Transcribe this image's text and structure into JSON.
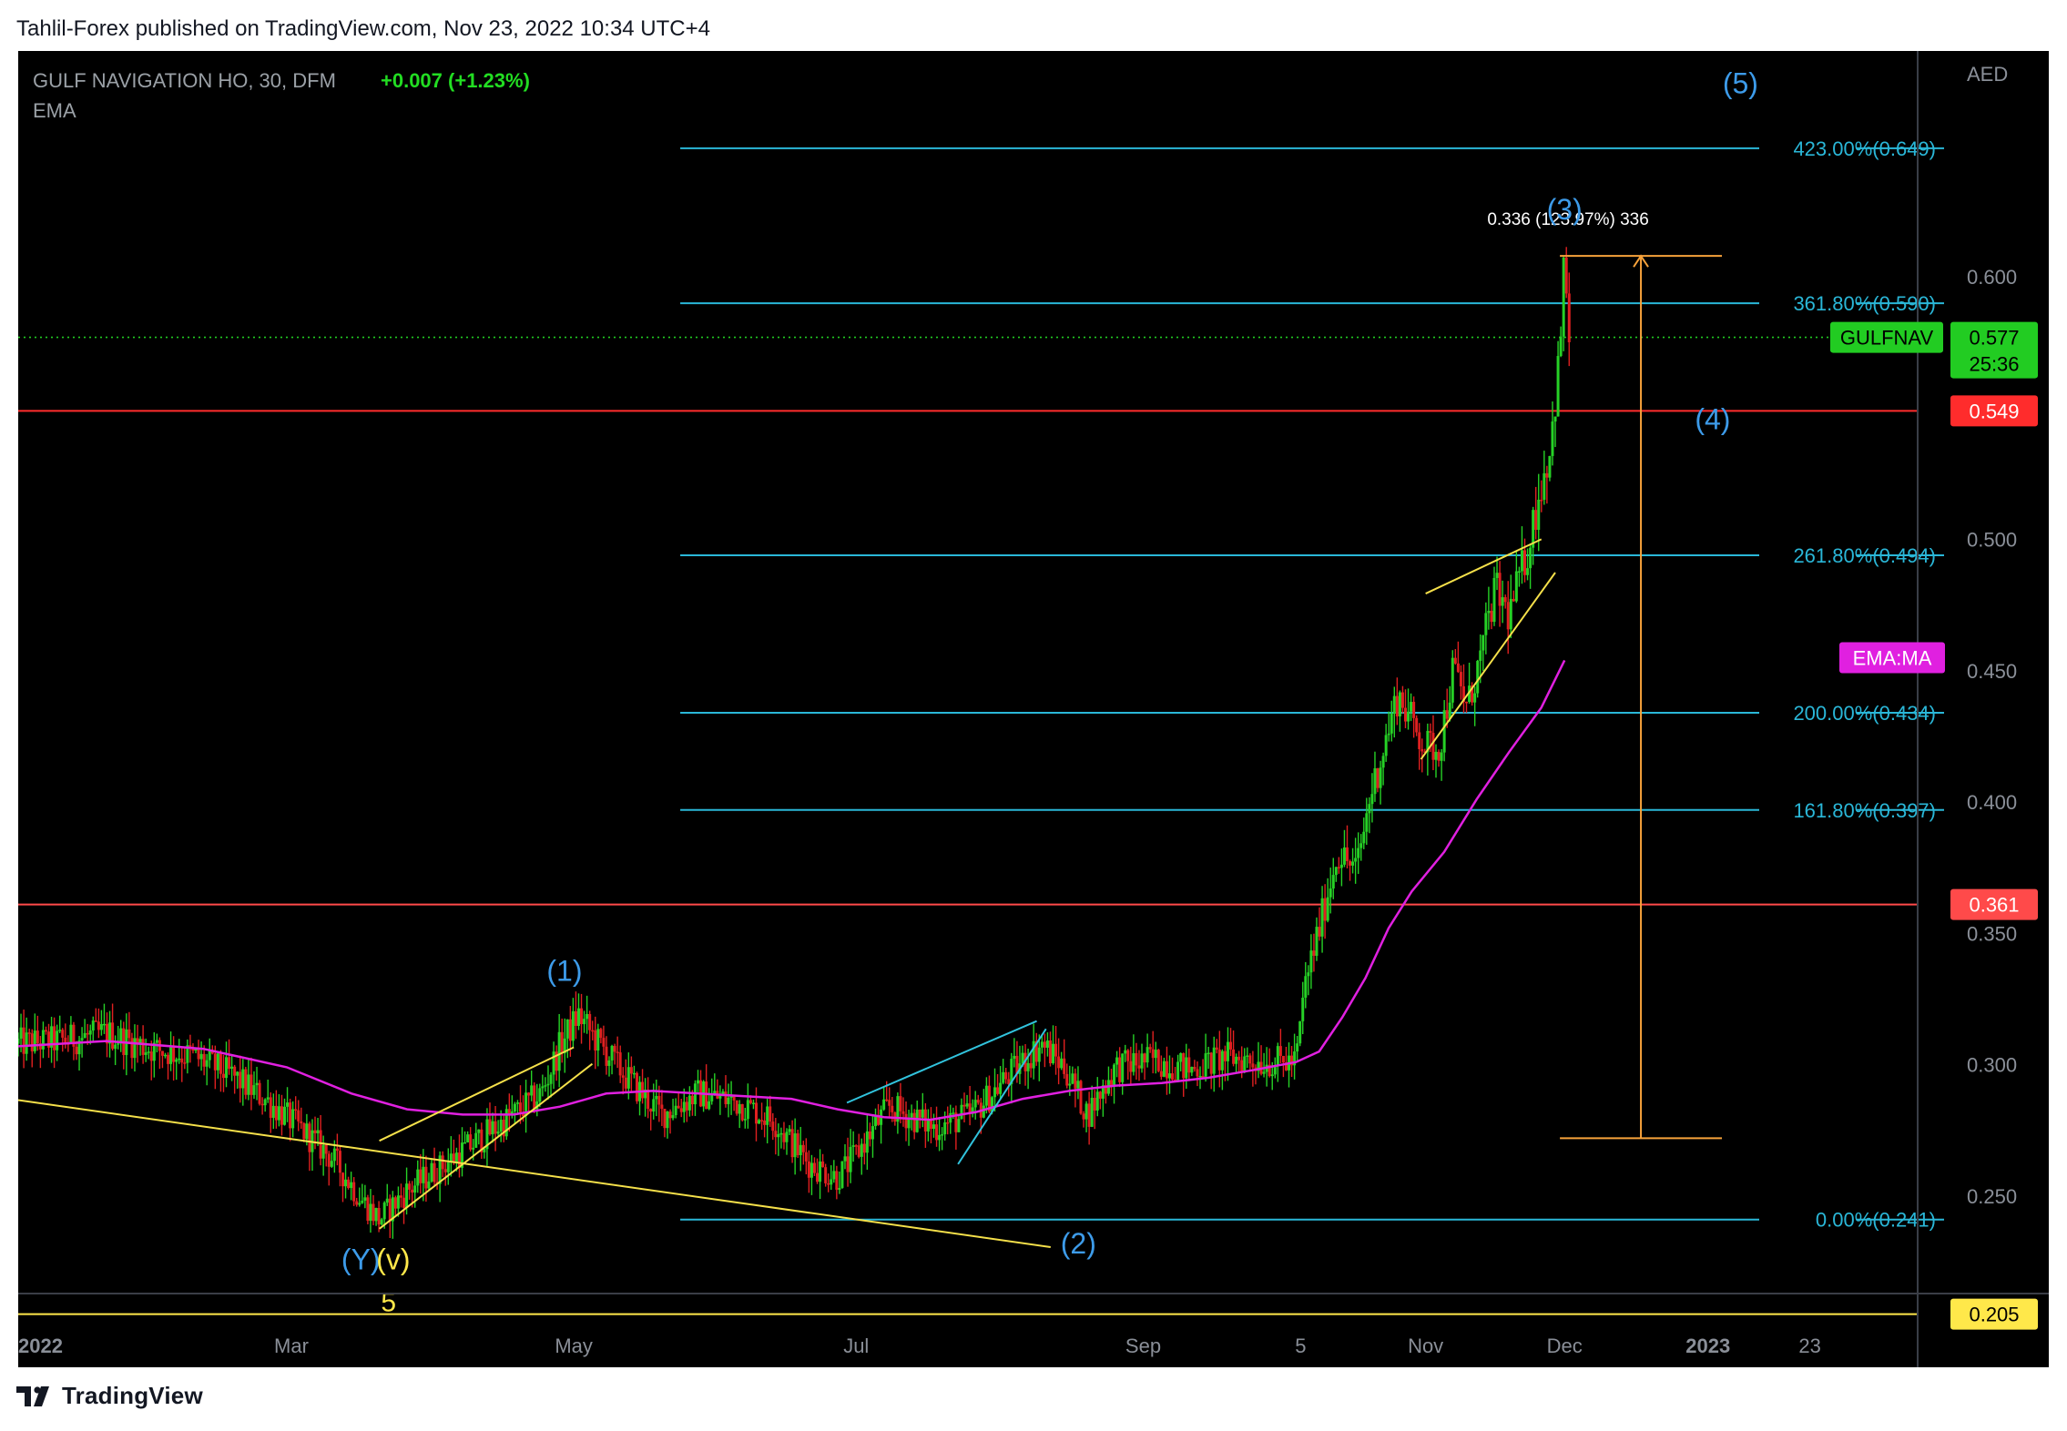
{
  "caption": "Tahlil-Forex published on TradingView.com, Nov 23, 2022 10:34 UTC+4",
  "brand": "TradingView",
  "chart_data": {
    "type": "candlestick",
    "symbol_line": "GULF NAVIGATION HO, 30, DFM",
    "change": "+0.007 (+1.23%)",
    "indicator": "EMA",
    "currency": "AED",
    "ylim": [
      0.184,
      0.664
    ],
    "y_ticks": [
      "0.250",
      "0.300",
      "0.350",
      "0.400",
      "0.450",
      "0.500",
      "0.600"
    ],
    "x_ticks": [
      "2022",
      "Mar",
      "May",
      "Jul",
      "Sep",
      "5",
      "Nov",
      "Dec",
      "2023",
      "23"
    ],
    "x_tick_dates": [
      "2022-01-01",
      "2022-03-01",
      "2022-05-01",
      "2022-07-01",
      "2022-09-01",
      "2022-10-05",
      "2022-11-01",
      "2022-12-01",
      "2023-01-01",
      "2023-01-23"
    ],
    "x_range": [
      "2022-01-01",
      "2023-02-20"
    ],
    "close_path": [
      [
        "2022-01-01",
        0.308
      ],
      [
        "2022-01-10",
        0.309
      ],
      [
        "2022-01-20",
        0.312
      ],
      [
        "2022-01-30",
        0.306
      ],
      [
        "2022-02-08",
        0.303
      ],
      [
        "2022-02-16",
        0.296
      ],
      [
        "2022-02-24",
        0.286
      ],
      [
        "2022-03-04",
        0.274
      ],
      [
        "2022-03-10",
        0.264
      ],
      [
        "2022-03-16",
        0.249
      ],
      [
        "2022-03-20",
        0.241
      ],
      [
        "2022-03-26",
        0.252
      ],
      [
        "2022-04-03",
        0.262
      ],
      [
        "2022-04-11",
        0.272
      ],
      [
        "2022-04-18",
        0.281
      ],
      [
        "2022-04-24",
        0.289
      ],
      [
        "2022-04-28",
        0.307
      ],
      [
        "2022-05-02",
        0.319
      ],
      [
        "2022-05-06",
        0.309
      ],
      [
        "2022-05-12",
        0.296
      ],
      [
        "2022-05-20",
        0.281
      ],
      [
        "2022-05-28",
        0.289
      ],
      [
        "2022-06-05",
        0.286
      ],
      [
        "2022-06-13",
        0.279
      ],
      [
        "2022-06-21",
        0.262
      ],
      [
        "2022-06-27",
        0.257
      ],
      [
        "2022-07-01",
        0.266
      ],
      [
        "2022-07-08",
        0.284
      ],
      [
        "2022-07-18",
        0.276
      ],
      [
        "2022-07-26",
        0.281
      ],
      [
        "2022-08-03",
        0.296
      ],
      [
        "2022-08-10",
        0.308
      ],
      [
        "2022-08-15",
        0.299
      ],
      [
        "2022-08-20",
        0.281
      ],
      [
        "2022-08-26",
        0.299
      ],
      [
        "2022-09-03",
        0.302
      ],
      [
        "2022-09-11",
        0.298
      ],
      [
        "2022-09-19",
        0.303
      ],
      [
        "2022-09-27",
        0.301
      ],
      [
        "2022-10-04",
        0.301
      ],
      [
        "2022-10-06",
        0.331
      ],
      [
        "2022-10-09",
        0.352
      ],
      [
        "2022-10-13",
        0.381
      ],
      [
        "2022-10-17",
        0.374
      ],
      [
        "2022-10-20",
        0.402
      ],
      [
        "2022-10-23",
        0.421
      ],
      [
        "2022-10-26",
        0.441
      ],
      [
        "2022-10-29",
        0.431
      ],
      [
        "2022-11-01",
        0.421
      ],
      [
        "2022-11-04",
        0.421
      ],
      [
        "2022-11-07",
        0.451
      ],
      [
        "2022-11-10",
        0.436
      ],
      [
        "2022-11-13",
        0.456
      ],
      [
        "2022-11-16",
        0.481
      ],
      [
        "2022-11-19",
        0.471
      ],
      [
        "2022-11-23",
        0.496
      ],
      [
        "2022-11-26",
        0.521
      ],
      [
        "2022-11-28",
        0.536
      ],
      [
        "2022-11-30",
        0.571
      ],
      [
        "2022-12-01",
        0.608
      ],
      [
        "2022-12-02",
        0.577
      ]
    ],
    "ema_path": [
      [
        "2022-01-01",
        0.307
      ],
      [
        "2022-01-20",
        0.309
      ],
      [
        "2022-02-10",
        0.306
      ],
      [
        "2022-02-28",
        0.299
      ],
      [
        "2022-03-14",
        0.289
      ],
      [
        "2022-03-26",
        0.283
      ],
      [
        "2022-04-07",
        0.281
      ],
      [
        "2022-04-18",
        0.281
      ],
      [
        "2022-04-28",
        0.284
      ],
      [
        "2022-05-08",
        0.289
      ],
      [
        "2022-05-18",
        0.29
      ],
      [
        "2022-05-28",
        0.289
      ],
      [
        "2022-06-07",
        0.288
      ],
      [
        "2022-06-17",
        0.287
      ],
      [
        "2022-06-27",
        0.283
      ],
      [
        "2022-07-07",
        0.28
      ],
      [
        "2022-07-17",
        0.279
      ],
      [
        "2022-07-27",
        0.282
      ],
      [
        "2022-08-06",
        0.287
      ],
      [
        "2022-08-16",
        0.29
      ],
      [
        "2022-08-26",
        0.292
      ],
      [
        "2022-09-05",
        0.293
      ],
      [
        "2022-09-15",
        0.295
      ],
      [
        "2022-09-25",
        0.298
      ],
      [
        "2022-10-04",
        0.301
      ],
      [
        "2022-10-09",
        0.305
      ],
      [
        "2022-10-14",
        0.318
      ],
      [
        "2022-10-19",
        0.333
      ],
      [
        "2022-10-24",
        0.352
      ],
      [
        "2022-10-29",
        0.366
      ],
      [
        "2022-11-05",
        0.381
      ],
      [
        "2022-11-12",
        0.401
      ],
      [
        "2022-11-19",
        0.419
      ],
      [
        "2022-11-26",
        0.436
      ],
      [
        "2022-12-01",
        0.454
      ]
    ],
    "fib_levels": [
      {
        "label": "423.00%(0.649)",
        "value": 0.649
      },
      {
        "label": "361.80%(0.590)",
        "value": 0.59
      },
      {
        "label": "261.80%(0.494)",
        "value": 0.494
      },
      {
        "label": "200.00%(0.434)",
        "value": 0.434
      },
      {
        "label": "161.80%(0.397)",
        "value": 0.397
      },
      {
        "label": "0.00%(0.241)",
        "value": 0.241
      }
    ],
    "fib_x_range": [
      "2022-05-24",
      "2023-02-02"
    ],
    "horizontal_lines": [
      {
        "value": 0.549,
        "label": "0.549",
        "color": "#ff2c2c"
      },
      {
        "value": 0.361,
        "label": "0.361",
        "color": "#ff4a4a"
      },
      {
        "value": 0.205,
        "label": "0.205",
        "color": "#ffe84a"
      }
    ],
    "last_price": {
      "symbol": "GULFNAV",
      "value": 0.577,
      "label": "0.577",
      "countdown": "25:36",
      "color": "#22cc22"
    },
    "ema_tag": {
      "label": "EMA:MA",
      "value": 0.455,
      "color": "#e020e0"
    },
    "measure": {
      "label": "0.336 (123.97%) 336",
      "from": 0.272,
      "to": 0.608,
      "x_range": [
        "2022-11-30",
        "2023-01-04"
      ],
      "color": "#f7a23b"
    },
    "wave_labels": [
      {
        "text": "(1)",
        "date": "2022-04-29",
        "value": 0.332,
        "color": "#3d9be9"
      },
      {
        "text": "(2)",
        "date": "2022-08-18",
        "value": 0.228,
        "color": "#3d9be9"
      },
      {
        "text": "(3)",
        "date": "2022-12-01",
        "value": 0.622,
        "color": "#3d9be9"
      },
      {
        "text": "(4)",
        "date": "2023-01-02",
        "value": 0.542,
        "color": "#3d9be9"
      },
      {
        "text": "(5)",
        "date": "2023-01-08",
        "value": 0.67,
        "color": "#3d9be9"
      },
      {
        "text": "(Y)",
        "date": "2022-03-16",
        "value": 0.222,
        "color": "#3d9be9"
      },
      {
        "text": "(v)",
        "date": "2022-03-23",
        "value": 0.222,
        "color": "#ffe84a"
      },
      {
        "text": "5",
        "date": "2022-03-22",
        "value": 0.206,
        "color": "#ffe84a"
      }
    ],
    "trend_lines": [
      {
        "from": [
          "2022-01-01",
          0.2865
        ],
        "to": [
          "2022-08-12",
          0.2305
        ],
        "color": "#f5e04a"
      },
      {
        "from": [
          "2022-03-20",
          0.2375
        ],
        "to": [
          "2022-05-05",
          0.3003
        ],
        "color": "#f5e04a"
      },
      {
        "from": [
          "2022-03-20",
          0.271
        ],
        "to": [
          "2022-05-01",
          0.3066
        ],
        "color": "#f5e04a"
      },
      {
        "from": [
          "2022-06-29",
          0.2855
        ],
        "to": [
          "2022-08-09",
          0.3166
        ],
        "color": "#31c3dd"
      },
      {
        "from": [
          "2022-07-23",
          0.2621
        ],
        "to": [
          "2022-08-11",
          0.3136
        ],
        "color": "#31c3dd"
      },
      {
        "from": [
          "2022-10-31",
          0.4163
        ],
        "to": [
          "2022-11-29",
          0.4874
        ],
        "color": "#f5e04a"
      },
      {
        "from": [
          "2022-11-01",
          0.4794
        ],
        "to": [
          "2022-11-26",
          0.5001
        ],
        "color": "#f5e04a"
      }
    ],
    "colors": {
      "background": "#000000",
      "up": "#26d126",
      "down": "#e02020",
      "ema": "#e020e0",
      "fib": "#2ab7d8",
      "axis_text": "#8a8f98",
      "legend_text": "#9aa0a6",
      "change_text": "#22dd22"
    }
  }
}
